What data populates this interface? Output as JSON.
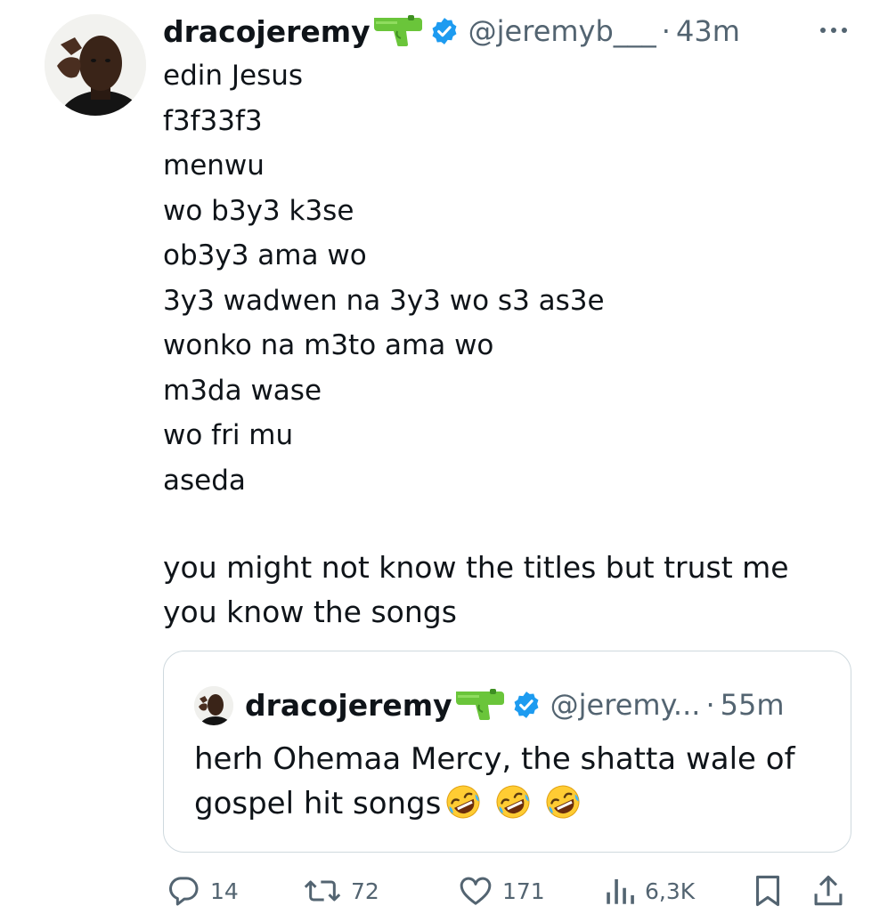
{
  "tweet": {
    "author": {
      "display_name": "dracojeremy",
      "handle": "@jeremyb___",
      "verified": true,
      "name_emoji": "water-pistol"
    },
    "separator": "·",
    "time": "43m",
    "more_icon": "more-horizontal-icon",
    "lines": [
      "edin Jesus",
      "f3f33f3",
      "menwu",
      "wo b3y3 k3se",
      "ob3y3 ama wo",
      "3y3 wadwen na 3y3 wo s3 as3e",
      "wonko na m3to ama wo",
      "m3da wase",
      "wo fri mu",
      "aseda"
    ],
    "closing_lines": [
      "you might not know the titles but trust me",
      "you know the songs"
    ]
  },
  "quoted_tweet": {
    "author": {
      "display_name": "dracojeremy",
      "handle": "@jeremy...",
      "verified": true,
      "name_emoji": "water-pistol"
    },
    "separator": "·",
    "time": "55m",
    "text_line1": "herh Ohemaa Mercy, the shatta wale of",
    "text_line2": "gospel hit songs",
    "trailing_emojis": [
      "rolling-on-floor-laughing",
      "rolling-on-floor-laughing",
      "rolling-on-floor-laughing"
    ]
  },
  "actions": {
    "replies": "14",
    "reposts": "72",
    "likes": "171",
    "views": "6,3K"
  },
  "colors": {
    "text": "#0f1419",
    "secondary": "#536471",
    "verified_blue": "#1d9bf0",
    "border": "#cfd9de"
  }
}
